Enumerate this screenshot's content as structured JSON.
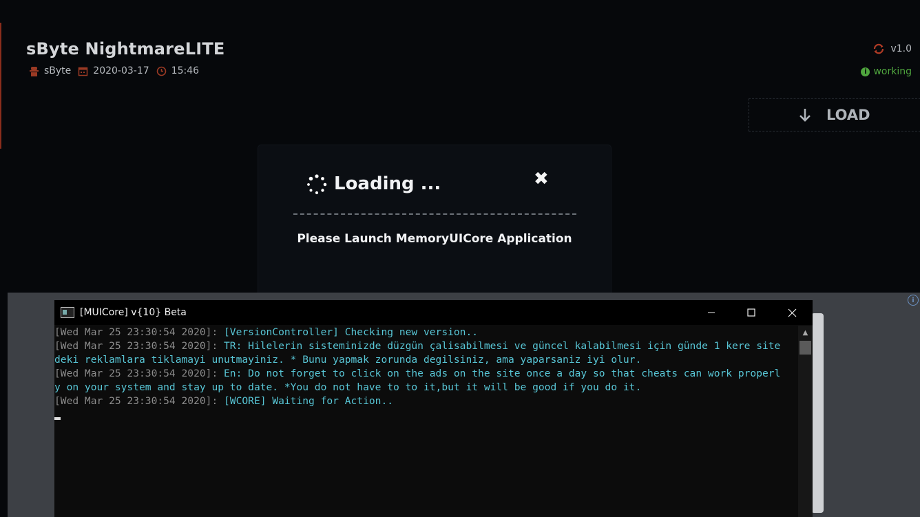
{
  "app": {
    "title": "sByte NightmareLITE",
    "author": "sByte",
    "date": "2020-03-17",
    "time": "15:46",
    "version": "v1.0",
    "status": "working",
    "load_label": "LOAD",
    "accent_color": "#8a2d1c",
    "status_color": "#4fa53e"
  },
  "modal": {
    "title": "Loading ...",
    "message": "Please Launch MemoryUICore Application",
    "close_glyph": "✖"
  },
  "console": {
    "title": "[MUICore] v{10} Beta",
    "lines": [
      {
        "ts": "[Wed Mar 25 23:30:54 2020]: ",
        "msg": "[VersionController] Checking new version.."
      },
      {
        "ts": "[Wed Mar 25 23:30:54 2020]: ",
        "msg": "TR: Hilelerin sisteminizde düzgün çalisabilmesi ve güncel kalabilmesi için günde 1 kere site"
      },
      {
        "ts": "",
        "msg": "deki reklamlara tiklamayi unutmayiniz. * Bunu yapmak zorunda degilsiniz, ama yaparsaniz iyi olur."
      },
      {
        "ts": "[Wed Mar 25 23:30:54 2020]: ",
        "msg": "En: Do not forget to click on the ads on the site once a day so that cheats can work properl"
      },
      {
        "ts": "",
        "msg": "y on your system and stay up to date. *You do not have to to it,but it will be good if you do it."
      },
      {
        "ts": "[Wed Mar 25 23:30:54 2020]: ",
        "msg": "[WCORE] Waiting for Action.."
      }
    ]
  },
  "icons": {
    "author": "user-secret-icon",
    "date": "calendar-icon",
    "time": "clock-icon",
    "version": "refresh-icon",
    "status": "info-icon",
    "load": "arrow-down-icon"
  }
}
